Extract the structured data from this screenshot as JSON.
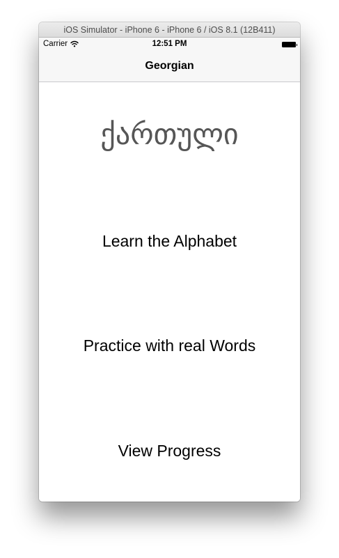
{
  "simulator": {
    "title": "iOS Simulator - iPhone 6 - iPhone 6 / iOS 8.1 (12B411)"
  },
  "status_bar": {
    "carrier": "Carrier",
    "time": "12:51 PM",
    "icons": [
      "wifi-icon",
      "battery-icon"
    ]
  },
  "nav_bar": {
    "title": "Georgian"
  },
  "main": {
    "logo_text": "ქართული",
    "menu": [
      {
        "label": "Learn the Alphabet"
      },
      {
        "label": "Practice with real Words"
      },
      {
        "label": "View Progress"
      }
    ]
  }
}
